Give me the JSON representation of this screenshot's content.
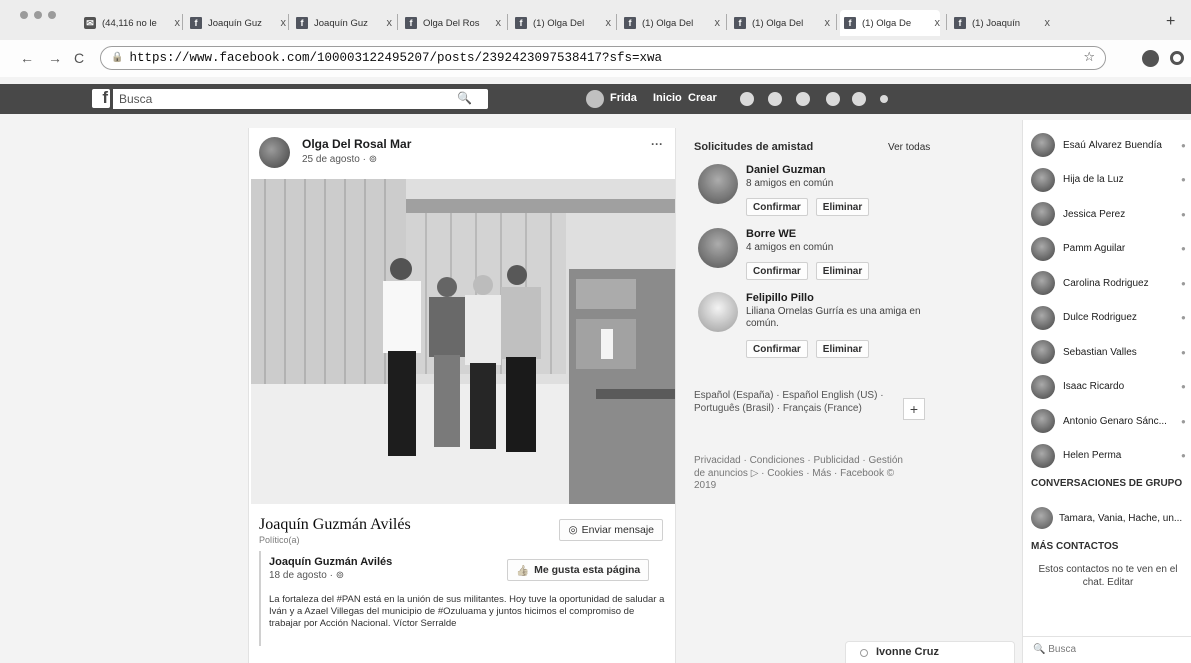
{
  "browser": {
    "tabs": [
      {
        "label": "(44,116 no le",
        "kind": "mail"
      },
      {
        "label": "Joaquín Guz",
        "kind": "fb"
      },
      {
        "label": "Joaquín Guz",
        "kind": "fb"
      },
      {
        "label": "Olga Del Ros",
        "kind": "fb"
      },
      {
        "label": "(1) Olga Del",
        "kind": "fb"
      },
      {
        "label": "(1) Olga Del",
        "kind": "fb"
      },
      {
        "label": "(1) Olga Del",
        "kind": "fb"
      },
      {
        "label": "(1) Olga De",
        "kind": "fb"
      },
      {
        "label": "(1) Joaquín",
        "kind": "fb"
      }
    ],
    "tab_close": "x",
    "new_tab": "+",
    "url": "https://www.facebook.com/100003122495207/posts/2392423097538417?sfs=xwa",
    "back": "←",
    "forward": "→",
    "reload": "C",
    "star": "☆"
  },
  "fb_header": {
    "logo": "f",
    "search_placeholder": "Busca",
    "user": "Frida",
    "home": "Inicio",
    "create": "Crear"
  },
  "post": {
    "author": "Olga Del Rosal Mar",
    "date": "25 de agosto · ⊚",
    "more": "···",
    "shared_name": "Joaquín Guzmán Avilés",
    "shared_category": "Político(a)",
    "send_message": "Enviar mensaje",
    "inner_author": "Joaquín Guzmán Avilés",
    "inner_date": "18 de agosto · ⊚",
    "like_page": "Me gusta esta página",
    "inner_text": "La fortaleza del #PAN está en la unión de sus militantes. Hoy tuve la oportunidad de saludar a Iván y a Azael Villegas del municipio de #Ozuluama y juntos hicimos el compromiso de trabajar por Acción Nacional. Víctor Serralde"
  },
  "friend_requests": {
    "title": "Solicitudes de amistad",
    "see_all": "Ver todas",
    "confirm": "Confirmar",
    "delete": "Eliminar",
    "items": [
      {
        "name": "Daniel Guzman",
        "mutual": "8 amigos en común"
      },
      {
        "name": "Borre WE",
        "mutual": "4 amigos en común"
      },
      {
        "name": "Felipillo Pillo",
        "mutual": "Liliana Ornelas Gurría es una amiga en común."
      }
    ]
  },
  "languages": "Español (España) · Español English (US) · Português (Brasil) · Français (France)",
  "lang_plus": "+",
  "footer": "Privacidad · Condiciones · Publicidad · Gestión de anuncios ▷ · Cookies · Más · Facebook © 2019",
  "chat": {
    "contacts": [
      "Esaú Álvarez Buendía",
      "Hija de la Luz",
      "Jessica Perez",
      "Pamm Aguilar",
      "Carolina Rodriguez",
      "Dulce Rodriguez",
      "Sebastian Valles",
      "Isaac Ricardo",
      "Antonio Genaro Sánc...",
      "Helen Perma"
    ],
    "group_header": "CONVERSACIONES DE GRUPO",
    "group_name": "Tamara, Vania, Hache, un...",
    "more_header": "MÁS CONTACTOS",
    "more_note": "Estos contactos no te ven en el chat. Editar",
    "search": "Busca"
  },
  "bottom_chat": "Ivonne Cruz"
}
